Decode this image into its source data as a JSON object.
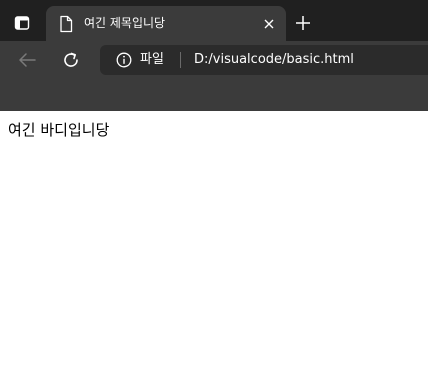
{
  "tab": {
    "title": "여긴 제목입니당"
  },
  "address_bar": {
    "site_label": "파일",
    "url": "D:/visualcode/basic.html"
  },
  "page": {
    "body_text": "여긴 바디입니당"
  },
  "icons": {
    "tab_actions": "tab-actions-icon",
    "favicon": "document-icon",
    "close": "close-icon",
    "new_tab": "plus-icon",
    "back": "arrow-left-icon",
    "refresh": "refresh-icon",
    "info": "info-icon"
  },
  "colors": {
    "tabstrip_bg": "#202020",
    "toolbar_bg": "#3b3b3b",
    "addressbar_bg": "#2b2b2b",
    "text_light": "#ffffff",
    "content_bg": "#ffffff"
  }
}
